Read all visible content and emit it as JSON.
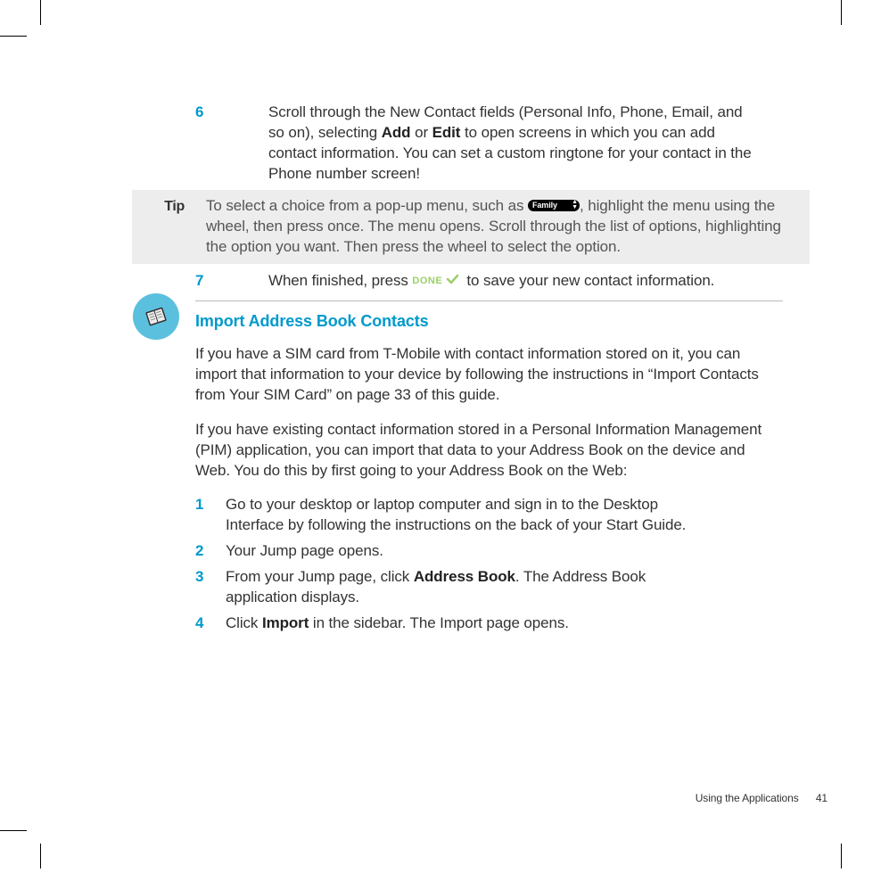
{
  "step6": {
    "num": "6",
    "line1a": "Scroll through the New Contact fields (Personal Info, Phone, Email, and so on), selecting ",
    "add": "Add",
    "or": " or ",
    "edit": "Edit",
    "line1b": " to open screens in which you can add contact information. You can set a custom ringtone for your contact in the Phone number screen!"
  },
  "tip": {
    "label": "Tip",
    "pre": "To select a choice from a pop-up menu, such as ",
    "pill": "Family",
    "post": ", highlight the menu using the wheel, then press once. The menu opens. Scroll through the list of options, highlighting the option you want. Then press the wheel to select the option."
  },
  "step7": {
    "num": "7",
    "pre": "When finished, press ",
    "done": "DONE",
    "post": " to save your new contact information."
  },
  "section": {
    "title": "Import Address Book Contacts",
    "p1": "If you have a SIM card from T-Mobile with contact information stored on it, you can import that information to your device by following the instructions in “Import Contacts from Your SIM Card” on page 33 of this guide.",
    "p2": "If you have existing contact information stored in a Personal Information Management (PIM) application, you can import that data to your Address Book on the device and Web. You do this by first going to your Address Book on the Web:"
  },
  "list": {
    "i1": {
      "num": "1",
      "text": "Go to your desktop or laptop computer and sign in to the Desktop Interface by following the instructions on the back of your Start Guide."
    },
    "i2": {
      "num": "2",
      "text": "Your Jump page opens."
    },
    "i3": {
      "num": "3",
      "pre": "From your Jump page, click ",
      "bold": "Address Book",
      "post": ". The Address Book application displays."
    },
    "i4": {
      "num": "4",
      "pre": "Click ",
      "bold": "Import",
      "post": " in the sidebar. The Import page opens."
    }
  },
  "footer": {
    "section": "Using the Applications",
    "page": "41"
  }
}
